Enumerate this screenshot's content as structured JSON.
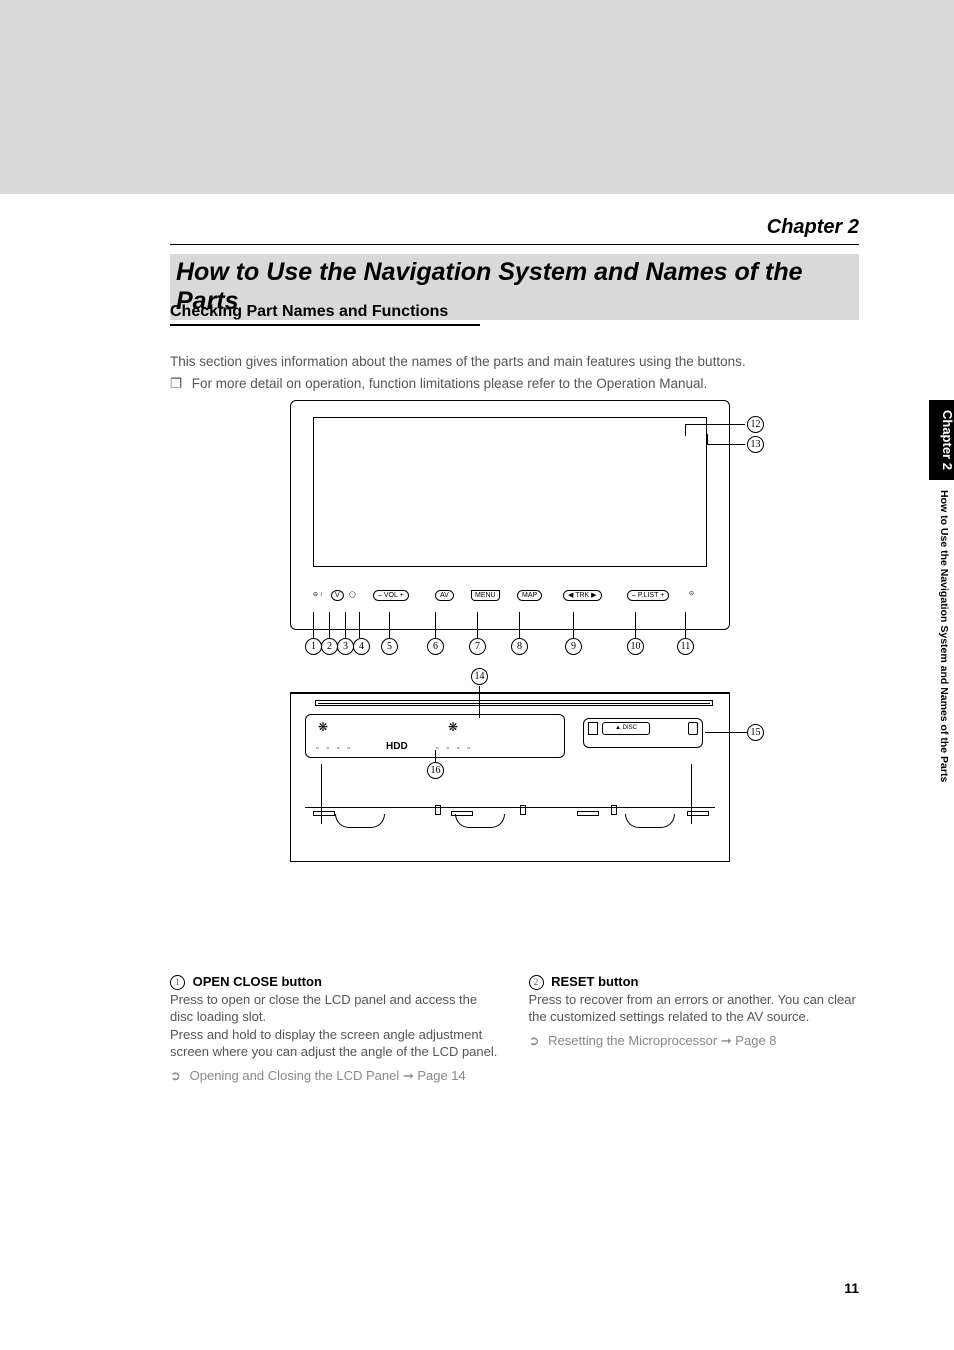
{
  "chapter": {
    "label": "Chapter 2"
  },
  "title": "How to Use the Navigation System and Names of the Parts",
  "section_heading": "Checking Part Names and Functions",
  "intro": {
    "line1": "This section gives information about the names of the parts and main features using the buttons.",
    "bullet": "❐",
    "line2": "For more detail on operation, function limitations please refer to the Operation Manual."
  },
  "sidebar": {
    "tab": "Chapter 2",
    "text": "How to Use the Navigation System and Names of the Parts"
  },
  "buttons": {
    "b1": "",
    "b2": "V",
    "b3": "",
    "b4": "",
    "b5": {
      "left": "–",
      "mid": "VOL",
      "right": "+"
    },
    "b6": "AV",
    "b7": "MENU",
    "b8": "MAP",
    "b9": {
      "left": "◀",
      "mid": "TRK",
      "right": "▶"
    },
    "b10": {
      "left": "–",
      "mid": "P.LIST",
      "right": "+"
    },
    "b11": ""
  },
  "lower": {
    "hdd": "HDD",
    "disc": "▲ DISC"
  },
  "callouts": {
    "c1": "1",
    "c2": "2",
    "c3": "3",
    "c4": "4",
    "c5": "5",
    "c6": "6",
    "c7": "7",
    "c8": "8",
    "c9": "9",
    "c10": "10",
    "c11": "11",
    "c12": "12",
    "c13": "13",
    "c14": "14",
    "c15": "15",
    "c16": "16"
  },
  "col1": {
    "num": "1",
    "head": "OPEN CLOSE button",
    "p1": "Press to open or close the LCD panel and access the disc loading slot.",
    "p2": "Press and hold to display the screen angle adjustment screen where you can adjust the angle of the LCD panel.",
    "ref_arrow": "➲",
    "ref": "Opening and Closing the LCD Panel ➞ Page 14"
  },
  "col2": {
    "num": "2",
    "head": "RESET button",
    "p1": "Press to recover from an errors or another. You can clear the customized settings related to the AV source.",
    "ref_arrow": "➲",
    "ref": "Resetting the Microprocessor ➞ Page 8"
  },
  "page_number": "11"
}
